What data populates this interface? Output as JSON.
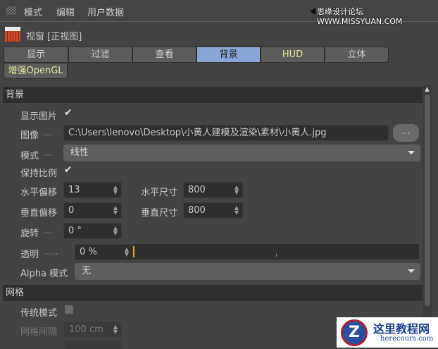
{
  "menu": {
    "items": [
      "模式",
      "编辑",
      "用户数据"
    ],
    "watermark": "思缘设计论坛 WWW.MISSYUAN.COM"
  },
  "panel": {
    "title": "视窗 [正视图]"
  },
  "tabs": [
    {
      "label": "显示"
    },
    {
      "label": "过滤"
    },
    {
      "label": "查看"
    },
    {
      "label": "背景",
      "active": true
    },
    {
      "label": "HUD"
    },
    {
      "label": "立体"
    }
  ],
  "tabs2": [
    {
      "label": "增强OpenGL"
    }
  ],
  "background": {
    "header": "背景",
    "show_image": {
      "label": "显示图片",
      "checked": true
    },
    "image": {
      "label": "图像",
      "value": "C:\\Users\\lenovo\\Desktop\\小黄人建模及渲染\\素材\\小黄人.jpg",
      "browse": "..."
    },
    "mode": {
      "label": "模式",
      "value": "线性"
    },
    "keep_ratio": {
      "label": "保持比例",
      "checked": true
    },
    "h_offset": {
      "label": "水平偏移",
      "value": "13"
    },
    "h_size": {
      "label": "水平尺寸",
      "value": "800"
    },
    "v_offset": {
      "label": "垂直偏移",
      "value": "0"
    },
    "v_size": {
      "label": "垂直尺寸",
      "value": "800"
    },
    "rotation": {
      "label": "旋转",
      "value": "0 °"
    },
    "transparency": {
      "label": "透明",
      "value": "0 %",
      "percent": 0
    },
    "alpha_mode": {
      "label": "Alpha 模式",
      "value": "无"
    }
  },
  "grid": {
    "header": "网格",
    "legacy": {
      "label": "传统模式",
      "checked": false
    },
    "spacing": {
      "label": "网格间隔",
      "value": "100 cm"
    }
  },
  "site_watermark": {
    "title": "这里教程网",
    "url": "herecours.com"
  },
  "dots": {
    "short": "...",
    "long": "....."
  }
}
